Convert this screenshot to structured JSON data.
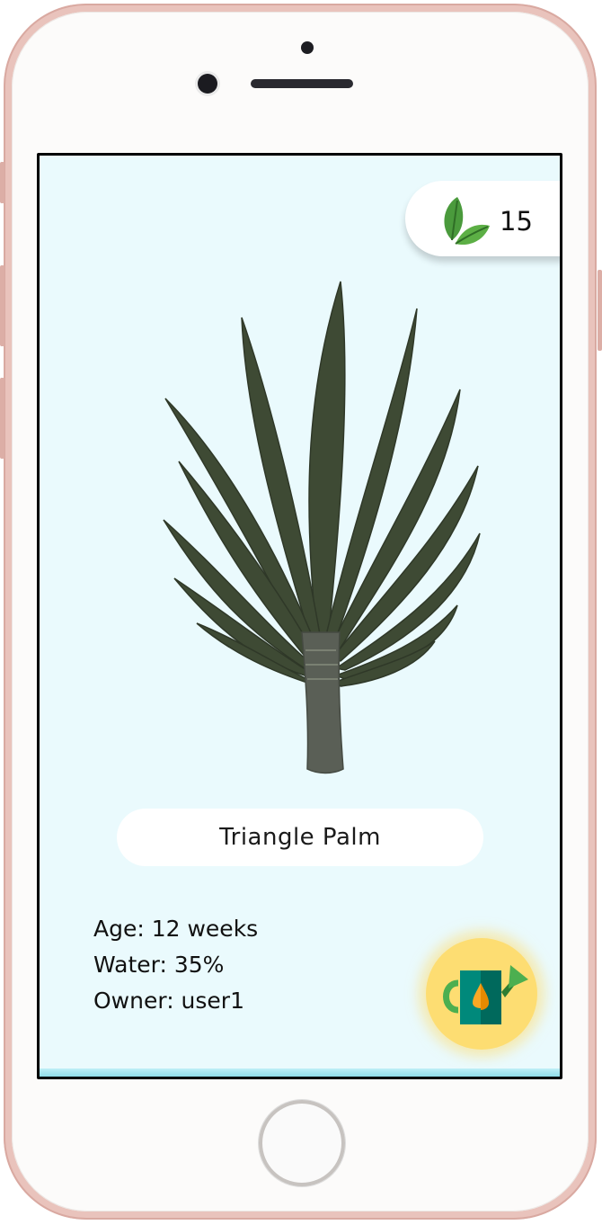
{
  "header": {
    "leaf_count": "15",
    "leaf_icon": "leaf-icon"
  },
  "plant": {
    "name": "Triangle Palm",
    "image": "palm-tree-illustration",
    "foliage_color": "#3e4a34",
    "trunk_color": "#5a5f56"
  },
  "stats": {
    "age": "Age: 12 weeks",
    "water": "Water: 35%",
    "owner": "Owner: user1"
  },
  "actions": {
    "water_icon": "watering-can-icon"
  },
  "colors": {
    "screen_background": "#eafafd",
    "water_button": "#fddd72",
    "leaf_green": "#4a9a3c"
  }
}
